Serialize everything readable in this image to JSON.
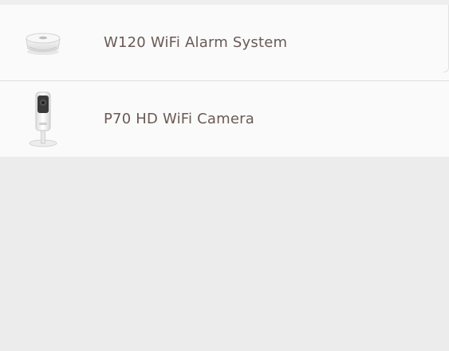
{
  "devices": [
    {
      "name": "W120 WiFi Alarm System",
      "icon": "alarm-hub-icon"
    },
    {
      "name": "P70 HD WiFi Camera",
      "icon": "camera-icon"
    }
  ],
  "colors": {
    "label": "#6a5a55",
    "row_background": "#fafafa",
    "page_background": "#ececec"
  }
}
